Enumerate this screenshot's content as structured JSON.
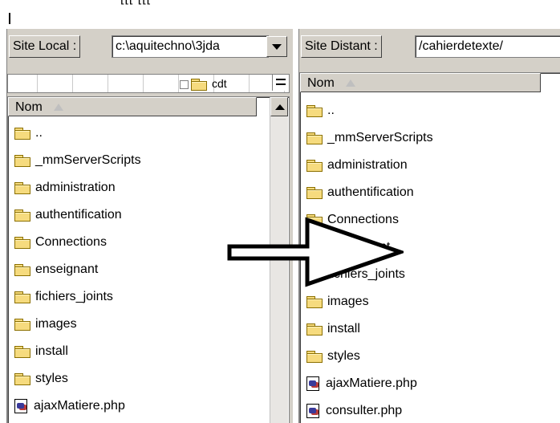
{
  "top": {
    "clipped_text": "[[[ [[["
  },
  "local": {
    "site_label": "Site Local :",
    "path": "c:\\aquitechno\\3jda",
    "tree_node": "cdt",
    "column_header": "Nom",
    "items": [
      {
        "name": "..",
        "type": "folder"
      },
      {
        "name": "_mmServerScripts",
        "type": "folder"
      },
      {
        "name": "administration",
        "type": "folder"
      },
      {
        "name": "authentification",
        "type": "folder"
      },
      {
        "name": "Connections",
        "type": "folder"
      },
      {
        "name": "enseignant",
        "type": "folder"
      },
      {
        "name": "fichiers_joints",
        "type": "folder"
      },
      {
        "name": "images",
        "type": "folder"
      },
      {
        "name": "install",
        "type": "folder"
      },
      {
        "name": "styles",
        "type": "folder"
      },
      {
        "name": "ajaxMatiere.php",
        "type": "php"
      }
    ]
  },
  "remote": {
    "site_label": "Site Distant :",
    "path": "/cahierdetexte/",
    "column_header": "Nom",
    "items": [
      {
        "name": "..",
        "type": "folder"
      },
      {
        "name": "_mmServerScripts",
        "type": "folder"
      },
      {
        "name": "administration",
        "type": "folder"
      },
      {
        "name": "authentification",
        "type": "folder"
      },
      {
        "name": "Connections",
        "type": "folder"
      },
      {
        "name": "enseignant",
        "type": "folder"
      },
      {
        "name": "fichiers_joints",
        "type": "folder"
      },
      {
        "name": "images",
        "type": "folder"
      },
      {
        "name": "install",
        "type": "folder"
      },
      {
        "name": "styles",
        "type": "folder"
      },
      {
        "name": "ajaxMatiere.php",
        "type": "php"
      },
      {
        "name": "consulter.php",
        "type": "php"
      }
    ]
  },
  "icons": {
    "folder": "folder-icon",
    "php": "php-file-icon",
    "sort": "sort-ascending-icon",
    "arrow": "right-arrow-icon"
  }
}
